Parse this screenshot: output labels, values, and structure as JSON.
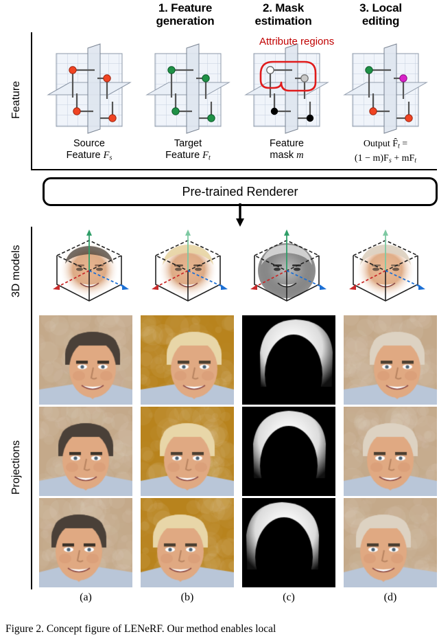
{
  "figure": {
    "caption": "Figure 2.  Concept figure of LENeRF. Our method enables local",
    "sublabels": [
      "(a)",
      "(b)",
      "(c)",
      "(d)"
    ]
  },
  "headers": [
    {
      "line1": "1. Feature",
      "line2": "generation"
    },
    {
      "line1": "2. Mask",
      "line2": "estimation"
    },
    {
      "line1": "3. Local",
      "line2": "editing"
    }
  ],
  "row_labels": [
    "Feature",
    "3D models",
    "Projections"
  ],
  "feature_row": {
    "attribute_label": "Attribute regions",
    "captions": [
      {
        "line1": "Source",
        "line2": "Feature ",
        "sym": "F",
        "sub": "s"
      },
      {
        "line1": "Target",
        "line2": "Feature ",
        "sym": "F",
        "sub": "t"
      },
      {
        "line1": "Feature",
        "line2": "mask ",
        "sym": "m",
        "sub": ""
      },
      {
        "line1": "Output",
        "line2": "",
        "sym": "",
        "sub": ""
      }
    ],
    "output_line1": "Output F̂",
    "output_line1_sub": "t",
    "output_eq": " =",
    "output_line2": "(1 − m)F",
    "output_line2_sub1": "s",
    "output_line2_mid": " + mF",
    "output_line2_sub2": "t",
    "dot_colors": {
      "source": "#f04423",
      "target": "#1f9146",
      "mask_inside": "#ffffff",
      "mask_outside": "#000000",
      "mask_gray": "#b3b3b3",
      "edited": "#d822c8",
      "region_outline": "#e01b1b"
    },
    "plane_fill": "#f0f4fa",
    "plane_grid": "#c3cedd"
  },
  "renderer": {
    "label": "Pre-trained Renderer"
  },
  "models_row": {
    "axis_colors": {
      "x": "#c92a2a",
      "y": "#2f9e68",
      "z": "#1c6fd4"
    },
    "cube_edge": "#222222",
    "items": [
      {
        "name": "source-model",
        "tone": "color-dark-hair"
      },
      {
        "name": "target-model",
        "tone": "color-blond-hair"
      },
      {
        "name": "mask-model",
        "tone": "grayscale-mask"
      },
      {
        "name": "output-model",
        "tone": "color-blond-hair"
      }
    ]
  },
  "projections": {
    "columns": [
      "source",
      "target",
      "mask",
      "output"
    ],
    "rows": [
      "left-view",
      "front-view",
      "right-view"
    ],
    "background_colors": {
      "source": "#c4a98a",
      "target": "#b8831d",
      "mask": "#000000",
      "output": "#c4a98a"
    },
    "hair_colors": {
      "source": "#4a4038",
      "target": "#e8d6a8",
      "output": "#ddd2c2"
    },
    "skin_color": "#e0a982",
    "shirt_color": "#b9c6d8"
  }
}
